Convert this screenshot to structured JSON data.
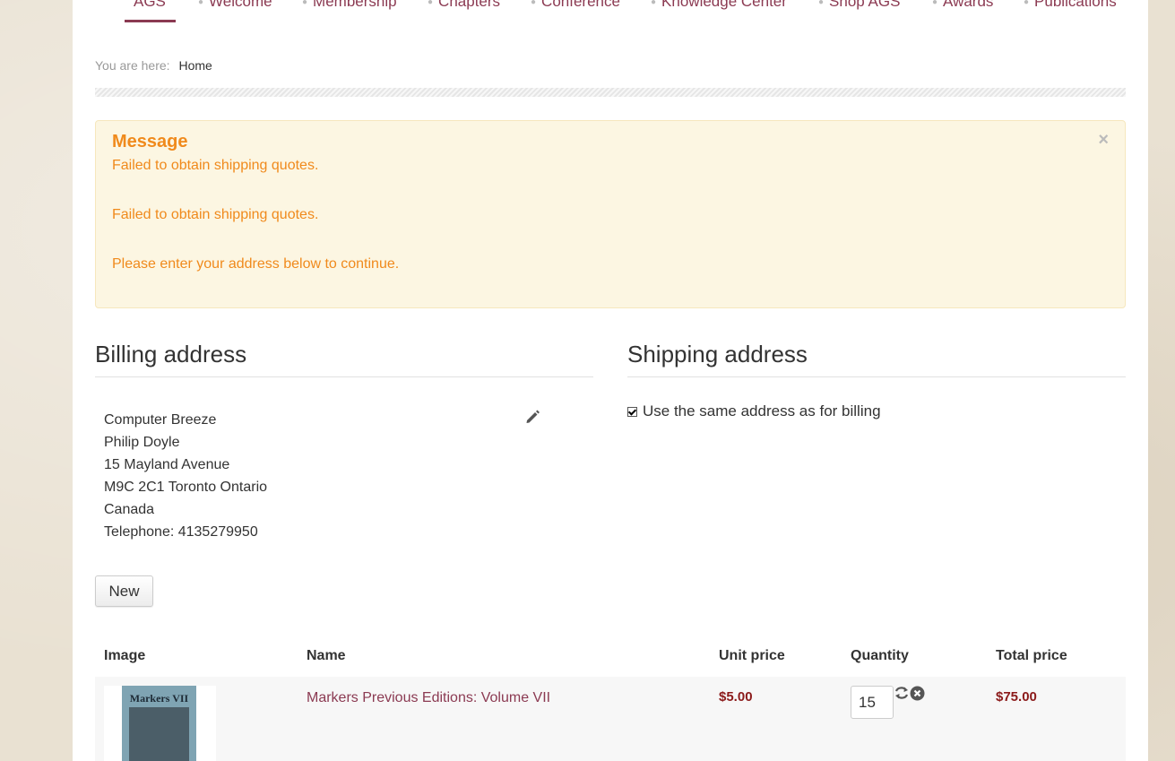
{
  "nav": {
    "items": [
      {
        "label": "AGS",
        "active": true
      },
      {
        "label": "Welcome"
      },
      {
        "label": "Membership"
      },
      {
        "label": "Chapters"
      },
      {
        "label": "Conference"
      },
      {
        "label": "Knowledge Center"
      },
      {
        "label": "Shop AGS"
      },
      {
        "label": "Awards"
      },
      {
        "label": "Publications"
      }
    ]
  },
  "breadcrumb": {
    "prefix": "You are here:",
    "current": "Home"
  },
  "message": {
    "title": "Message",
    "lines": [
      "Failed to obtain shipping quotes.",
      "Failed to obtain shipping quotes.",
      "Please enter your address below to continue."
    ],
    "close": "×"
  },
  "billing": {
    "title": "Billing address",
    "lines": [
      "Computer Breeze",
      "Philip Doyle",
      "15 Mayland Avenue",
      "M9C 2C1 Toronto Ontario",
      "Canada",
      "Telephone: 4135279950"
    ],
    "new_button": "New"
  },
  "shipping": {
    "title": "Shipping address",
    "same_as_billing_label": "Use the same address as for billing",
    "same_as_billing_checked": true
  },
  "cart": {
    "headers": {
      "image": "Image",
      "name": "Name",
      "unit_price": "Unit price",
      "quantity": "Quantity",
      "total_price": "Total price"
    },
    "items": [
      {
        "image_title": "Markers VII",
        "name": "Markers Previous Editions: Volume VII",
        "unit_price": "$5.00",
        "quantity": "15",
        "total_price": "$75.00"
      }
    ]
  },
  "icons": {
    "edit": "pencil-icon",
    "refresh": "refresh-icon",
    "remove": "remove-icon",
    "close": "close-icon"
  },
  "colors": {
    "link": "#8b3a52",
    "alert_text": "#f08a1c",
    "alert_bg": "#fcf6e2",
    "price": "#8b1a1a"
  }
}
